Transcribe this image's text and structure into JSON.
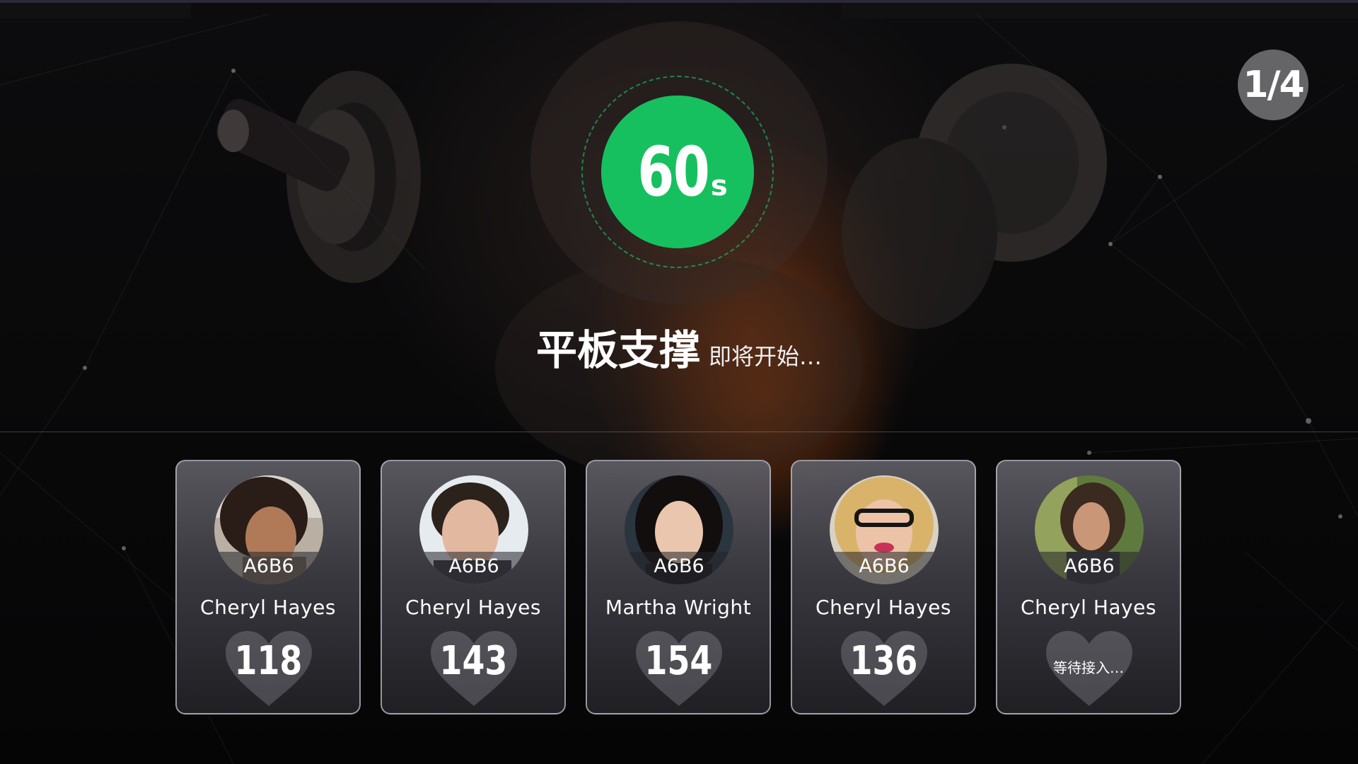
{
  "timer": {
    "value": "60",
    "unit": "s"
  },
  "page_indicator": "1/4",
  "title": {
    "exercise": "平板支撑",
    "status": "即将开始…"
  },
  "participants": [
    {
      "tag": "A6B6",
      "name": "Cheryl Hayes",
      "count": "118",
      "waiting": ""
    },
    {
      "tag": "A6B6",
      "name": "Cheryl Hayes",
      "count": "143",
      "waiting": ""
    },
    {
      "tag": "A6B6",
      "name": "Martha Wright",
      "count": "154",
      "waiting": ""
    },
    {
      "tag": "A6B6",
      "name": "Cheryl Hayes",
      "count": "136",
      "waiting": ""
    },
    {
      "tag": "A6B6",
      "name": "Cheryl Hayes",
      "count": "",
      "waiting": "等待接入…"
    }
  ],
  "colors": {
    "timer_green": "#17c05f",
    "badge_gray": "#6e6e70",
    "card_border": "#bebec8"
  },
  "icons": {
    "heart": "heart-icon"
  }
}
